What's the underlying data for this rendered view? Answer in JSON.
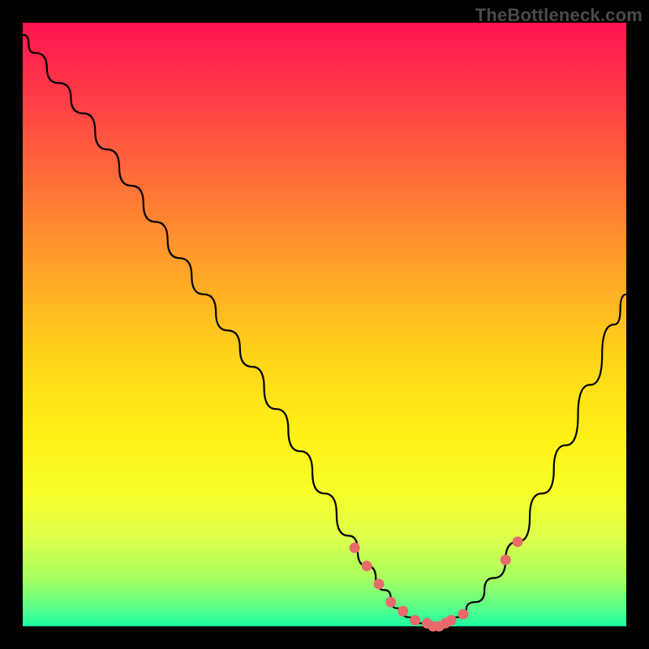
{
  "watermark": "TheBottleneck.com",
  "colors": {
    "background": "#000000",
    "gradient_top": "#ff1450",
    "gradient_bottom": "#1affa5",
    "curve": "#000000",
    "marker": "#e86a6a"
  },
  "chart_data": {
    "type": "line",
    "title": "",
    "xlabel": "",
    "ylabel": "",
    "xlim": [
      0,
      100
    ],
    "ylim": [
      0,
      100
    ],
    "grid": false,
    "series": [
      {
        "name": "bottleneck-curve",
        "x": [
          0,
          2,
          6,
          10,
          14,
          18,
          22,
          26,
          30,
          34,
          38,
          42,
          46,
          50,
          54,
          57,
          60,
          62,
          64,
          66,
          68,
          70,
          72,
          75,
          78,
          82,
          86,
          90,
          94,
          98,
          100
        ],
        "values": [
          98,
          95,
          90,
          85,
          79,
          73,
          67,
          61,
          55,
          49,
          43,
          36,
          29,
          22,
          15,
          10,
          6,
          3,
          1.5,
          0.5,
          0,
          0.5,
          1.5,
          4,
          8,
          14,
          22,
          30,
          40,
          50,
          55
        ]
      }
    ],
    "markers": {
      "name": "highlight-points",
      "x": [
        55,
        57,
        59,
        61,
        63,
        65,
        67,
        68,
        69,
        70,
        71,
        73,
        80,
        82
      ],
      "values": [
        13,
        10,
        7,
        4,
        2.5,
        1,
        0.5,
        0,
        0,
        0.5,
        1,
        2,
        11,
        14
      ]
    }
  }
}
